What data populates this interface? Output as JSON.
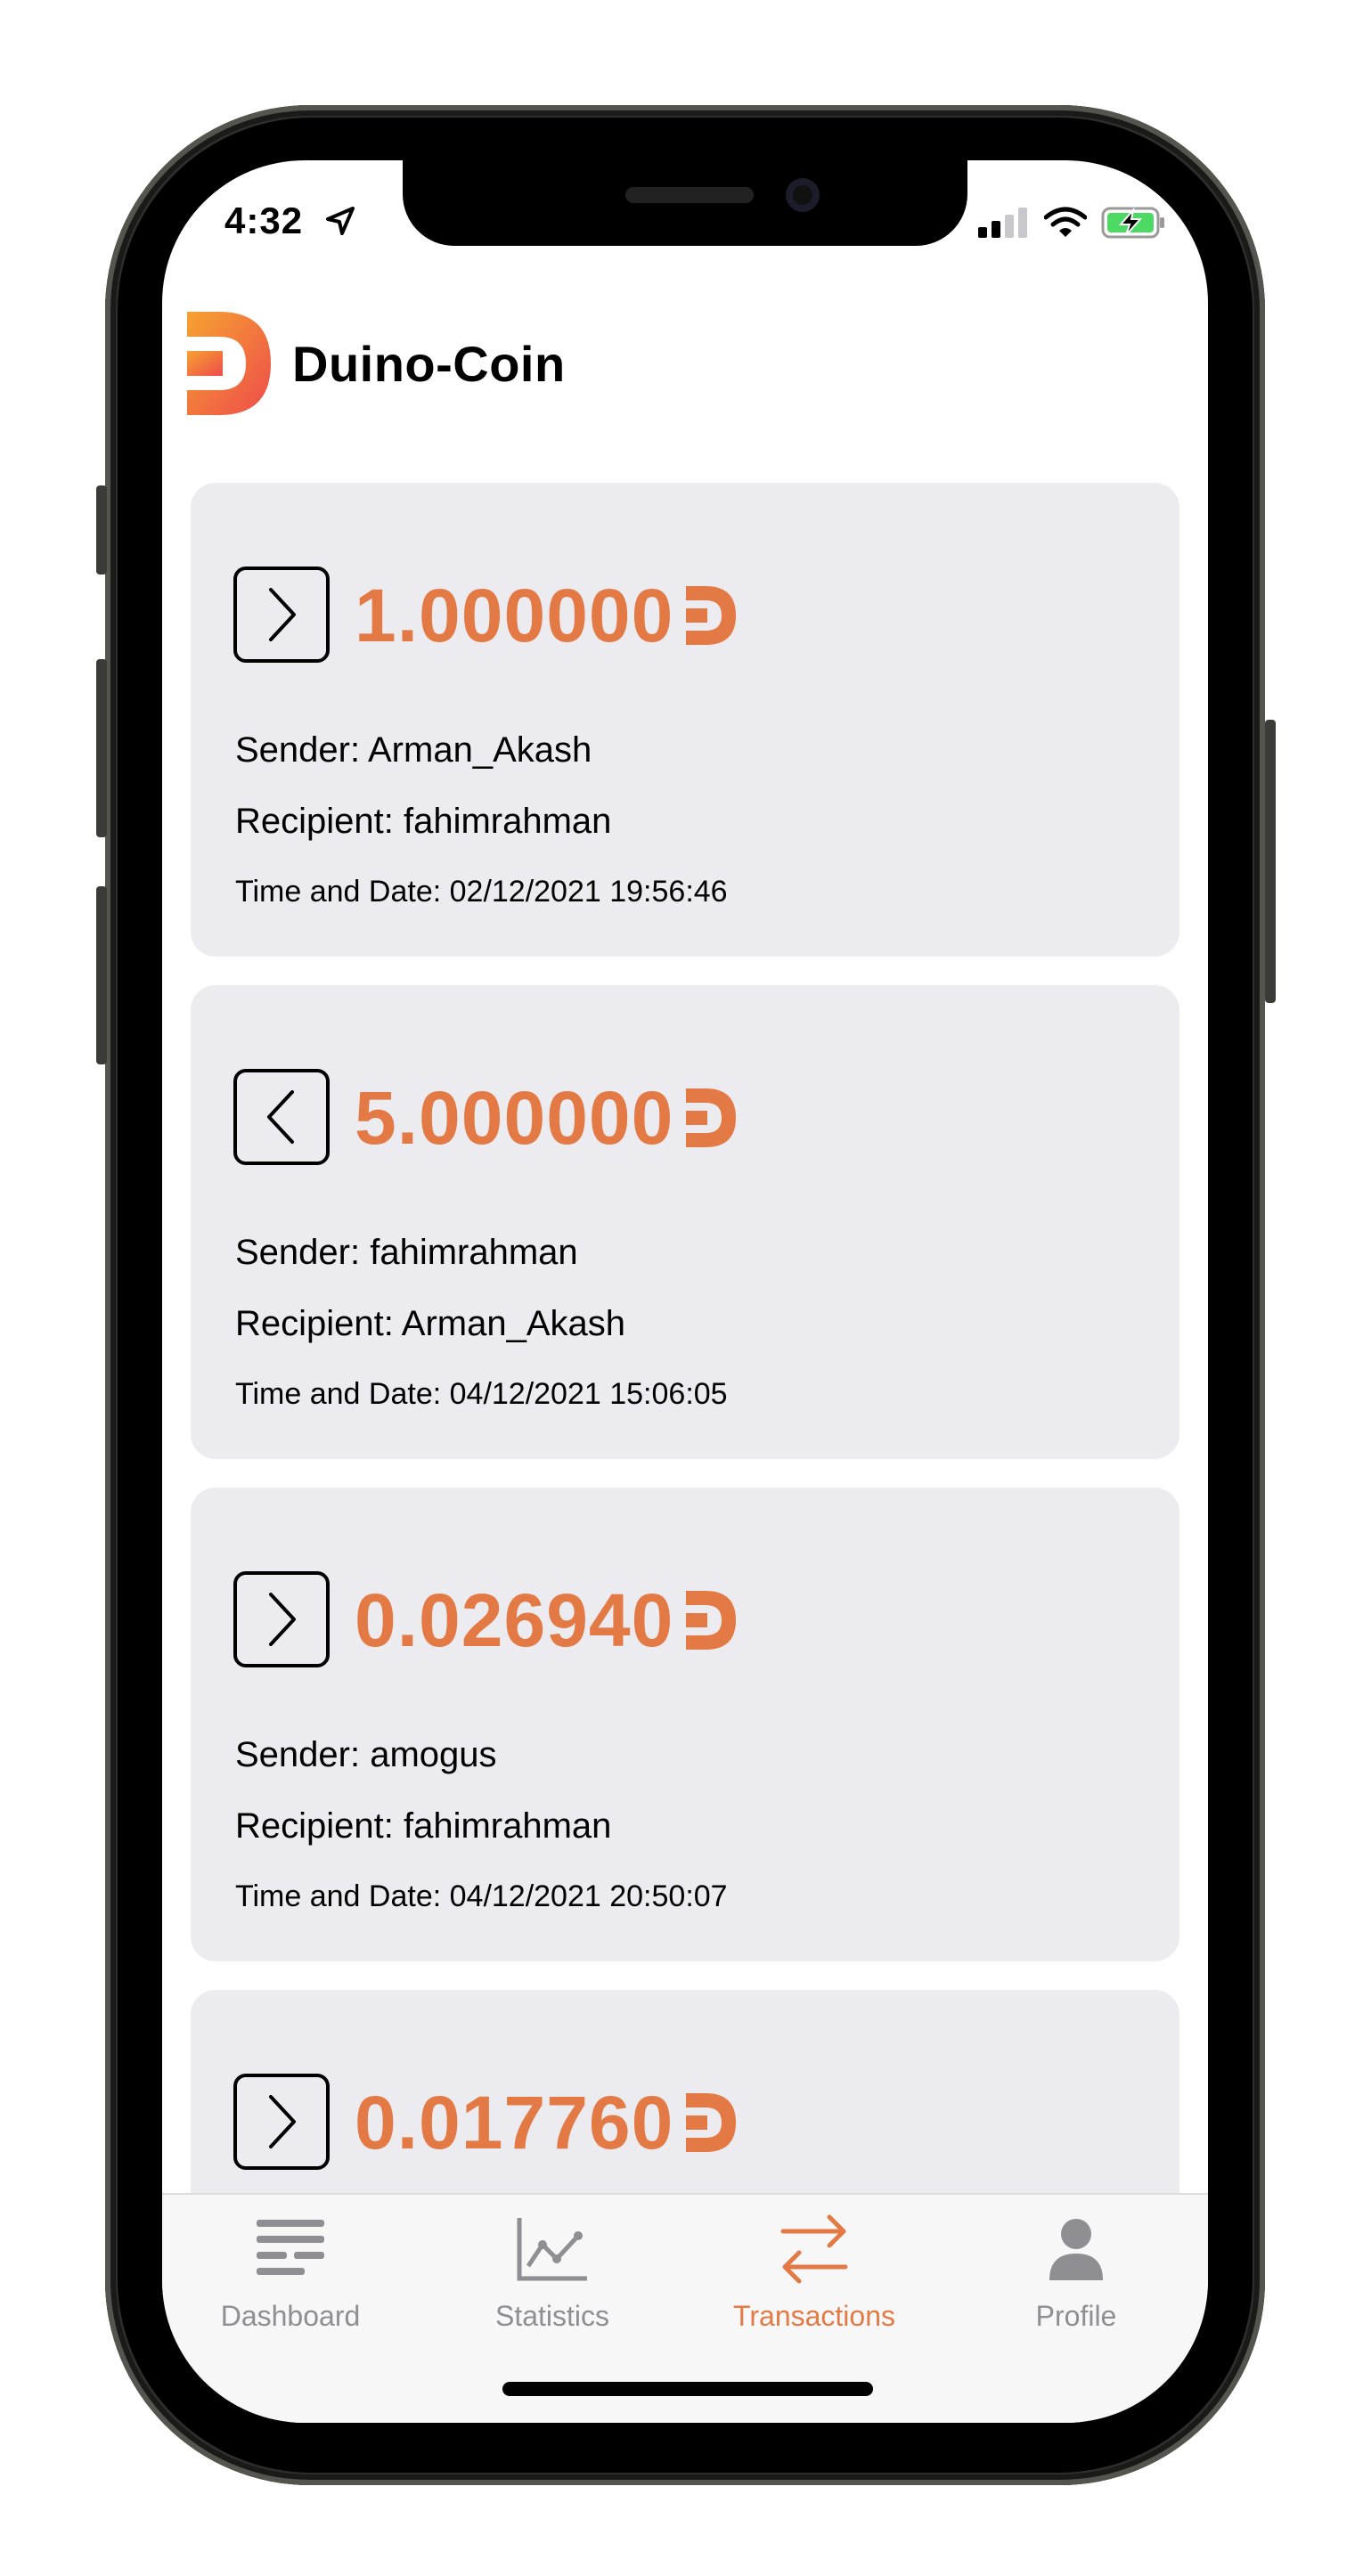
{
  "status": {
    "time": "4:32"
  },
  "app": {
    "title": "Duino-Coin"
  },
  "transactions": [
    {
      "direction": "outgoing",
      "amount": "1.000000",
      "sender": "Sender: Arman_Akash",
      "recipient": "Recipient: fahimrahman",
      "datetime": "Time and Date: 02/12/2021 19:56:46"
    },
    {
      "direction": "incoming",
      "amount": "5.000000",
      "sender": "Sender: fahimrahman",
      "recipient": "Recipient: Arman_Akash",
      "datetime": "Time and Date: 04/12/2021 15:06:05"
    },
    {
      "direction": "outgoing",
      "amount": "0.026940",
      "sender": "Sender: amogus",
      "recipient": "Recipient: fahimrahman",
      "datetime": "Time and Date: 04/12/2021 20:50:07"
    },
    {
      "direction": "outgoing",
      "amount": "0.017760"
    }
  ],
  "tabs": [
    {
      "label": "Dashboard",
      "icon": "dashboard-icon",
      "active": false
    },
    {
      "label": "Statistics",
      "icon": "chart-icon",
      "active": false
    },
    {
      "label": "Transactions",
      "icon": "transfer-arrows-icon",
      "active": true
    },
    {
      "label": "Profile",
      "icon": "person-icon",
      "active": false
    }
  ],
  "colors": {
    "accent": "#e37a45",
    "card": "#ececf0",
    "inactive": "#8e8e93",
    "battery": "#4cd964"
  }
}
